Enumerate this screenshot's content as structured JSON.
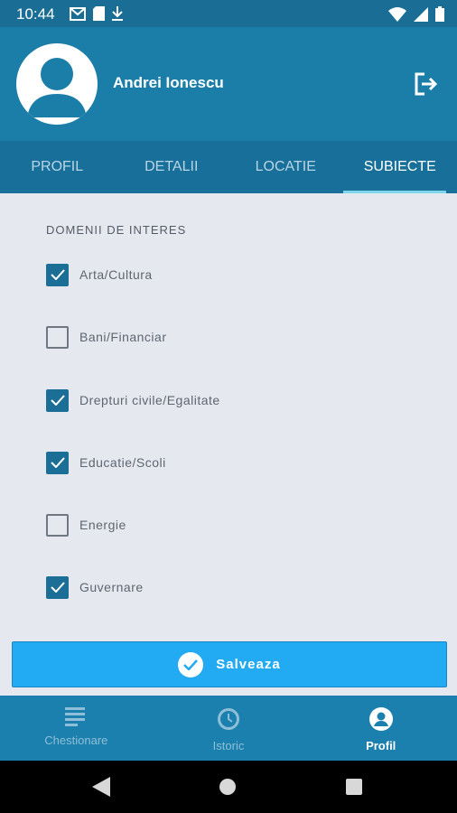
{
  "status_bar": {
    "time": "10:44"
  },
  "profile": {
    "name": "Andrei Ionescu"
  },
  "tabs": [
    {
      "label": "PROFIL",
      "active": false
    },
    {
      "label": "DETALII",
      "active": false
    },
    {
      "label": "LOCATIE",
      "active": false
    },
    {
      "label": "SUBIECTE",
      "active": true
    }
  ],
  "interests": {
    "section_title": "DOMENII DE INTERES",
    "items": [
      {
        "label": "Arta/Cultura",
        "checked": true
      },
      {
        "label": "Bani/Financiar",
        "checked": false
      },
      {
        "label": "Drepturi civile/Egalitate",
        "checked": true
      },
      {
        "label": "Educatie/Scoli",
        "checked": true
      },
      {
        "label": "Energie",
        "checked": false
      },
      {
        "label": "Guvernare",
        "checked": true
      }
    ]
  },
  "save_button": {
    "label": "Salveaza"
  },
  "bottom_nav": [
    {
      "label": "Chestionare",
      "icon": "list-icon",
      "active": false
    },
    {
      "label": "Istoric",
      "icon": "clock-icon",
      "active": false
    },
    {
      "label": "Profil",
      "icon": "account-circle-icon",
      "active": true
    }
  ],
  "colors": {
    "header": "#1b7ea9",
    "tab_bar": "#18709a",
    "checkbox_checked": "#1b6e95",
    "save_button": "#22aaf2",
    "background": "#e6e8ef"
  }
}
